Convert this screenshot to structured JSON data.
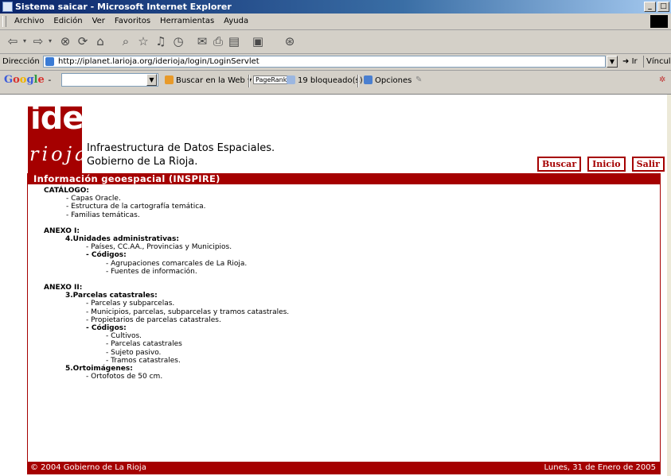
{
  "window": {
    "title": "Sistema saicar - Microsoft Internet Explorer"
  },
  "menubar": {
    "items": [
      "Archivo",
      "Edición",
      "Ver",
      "Favoritos",
      "Herramientas",
      "Ayuda"
    ]
  },
  "addressbar": {
    "label": "Dirección",
    "url": "http://iplanet.larioja.org/iderioja/login/LoginServlet",
    "go_label": "Ir",
    "links_label": "Vínculos"
  },
  "googlebar": {
    "logo": "Google -",
    "search_web": "Buscar en la Web",
    "pagerank": "PageRank",
    "blocked": "19 bloqueado(s)",
    "options": "Opciones"
  },
  "site": {
    "logo_top": "ide",
    "logo_bottom": "rioja",
    "title_line1": "Infraestructura de Datos Espaciales.",
    "title_line2": "Gobierno de La Rioja.",
    "buttons": {
      "buscar": "Buscar",
      "inicio": "Inicio",
      "salir": "Salir"
    },
    "section_title": "Información geoespacial (INSPIRE)"
  },
  "content": {
    "catalogo": {
      "heading": "CATÁLOGO:",
      "items": [
        "- Capas Oracle.",
        "- Estructura de la cartografía temática.",
        "- Familias temáticas."
      ]
    },
    "anexo1": {
      "heading": "ANEXO I:",
      "sub": "4.Unidades administrativas:",
      "items": [
        "- Países, CC.AA., Provincias y Municipios."
      ],
      "codigos_label": "- Códigos:",
      "codigos": [
        "- Agrupaciones comarcales de La Rioja.",
        "- Fuentes de información."
      ]
    },
    "anexo2": {
      "heading": "ANEXO II:",
      "sub": "3.Parcelas catastrales:",
      "items": [
        "- Parcelas y subparcelas.",
        "- Municipios, parcelas, subparcelas y tramos catastrales.",
        "- Propietarios de parcelas catastrales."
      ],
      "codigos_label": "- Códigos:",
      "codigos": [
        "- Cultivos.",
        "- Parcelas catastrales",
        "- Sujeto pasivo.",
        "- Tramos catastrales."
      ],
      "sub2": "5.Ortoimágenes:",
      "items2": [
        "- Ortofotos de 50 cm."
      ]
    }
  },
  "footer": {
    "left": "© 2004 Gobierno de La Rioja",
    "right": "Lunes, 31 de Enero de 2005"
  },
  "colors": {
    "brand_red": "#a50000",
    "title_blue": "#0a246a"
  }
}
